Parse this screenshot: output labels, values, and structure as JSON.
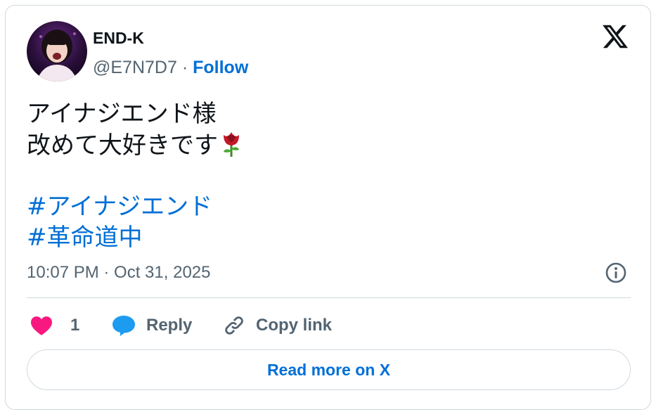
{
  "author": {
    "display_name": "END-K",
    "handle": "@E7N7D7",
    "separator": "·",
    "follow_label": "Follow"
  },
  "tweet": {
    "lines": [
      "アイナジエンド様",
      "改めて大好きです"
    ],
    "emoji": "rose",
    "hashtags": [
      "#アイナジエンド",
      "#革命道中"
    ]
  },
  "timestamp": "10:07 PM · Oct 31, 2025",
  "actions": {
    "like_count": "1",
    "reply_label": "Reply",
    "copy_label": "Copy link"
  },
  "read_more_label": "Read more on X",
  "colors": {
    "link": "#006fd6",
    "muted": "#536471",
    "heart": "#f91880",
    "reply_bubble": "#1d9bf0",
    "border": "#cfd9de"
  },
  "icons": [
    "x-logo-icon",
    "info-icon",
    "heart-icon",
    "reply-bubble-icon",
    "link-icon",
    "rose-emoji-icon"
  ]
}
